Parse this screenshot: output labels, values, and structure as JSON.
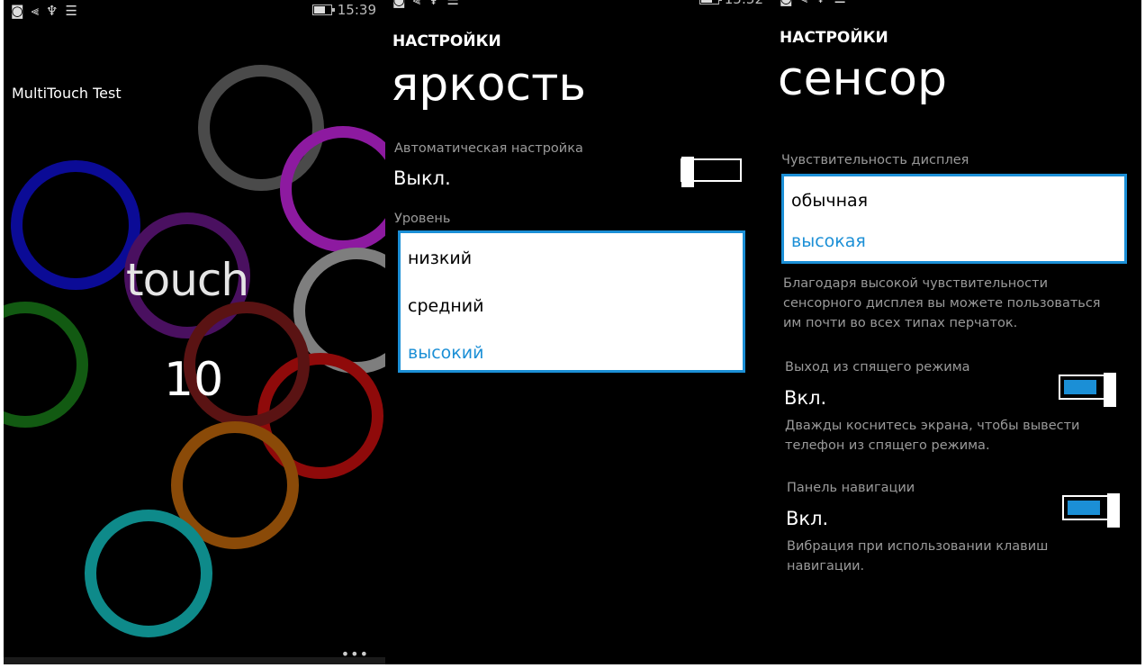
{
  "panel1": {
    "status_icons": [
      "◙",
      "⫷",
      "♆",
      "☰"
    ],
    "status_time": "15:39",
    "app_title": "MultiTouch Test",
    "touch_word": "touch",
    "touch_count": "10",
    "appbar_dots": "•••",
    "ring_colors": [
      "#4a4a4a",
      "#8d1aa0",
      "#0b0b96",
      "#4a1060",
      "#7e7e7e",
      "#125a12",
      "#8f0a0a",
      "#5a1313",
      "#8a4a08",
      "#0e8a8a"
    ]
  },
  "panel2": {
    "status_icons": [
      "◙",
      "⫷",
      "♆",
      "☰"
    ],
    "status_time": "15:52",
    "section": "НАСТРОЙКИ",
    "title": "яркость",
    "auto_label": "Автоматическая настройка",
    "auto_value": "Выкл.",
    "level_label": "Уровень",
    "level_options": [
      "низкий",
      "средний",
      "высокий"
    ],
    "level_selected": "высокий"
  },
  "panel3": {
    "status_icons": [
      "◙",
      "⫷",
      "♆",
      "☰"
    ],
    "section": "НАСТРОЙКИ",
    "title": "сенсор",
    "sensitivity_label": "Чувствительность дисплея",
    "sensitivity_options": [
      "обычная",
      "высокая"
    ],
    "sensitivity_selected": "высокая",
    "sensitivity_desc_lines": [
      "Благодаря высокой чувствительности",
      "сенсорного дисплея вы можете пользоваться",
      "им почти во всех типах перчаток."
    ],
    "wake_label": "Выход из спящего режима",
    "wake_value": "Вкл.",
    "wake_desc_lines": [
      "Дважды коснитесь экрана, чтобы вывести",
      "телефон из спящего режима."
    ],
    "navbar_label": "Панель навигации",
    "navbar_value": "Вкл.",
    "navbar_desc_lines": [
      "Вибрация при использовании клавиш",
      "навигации."
    ]
  },
  "accent_color": "#1b8fd6"
}
